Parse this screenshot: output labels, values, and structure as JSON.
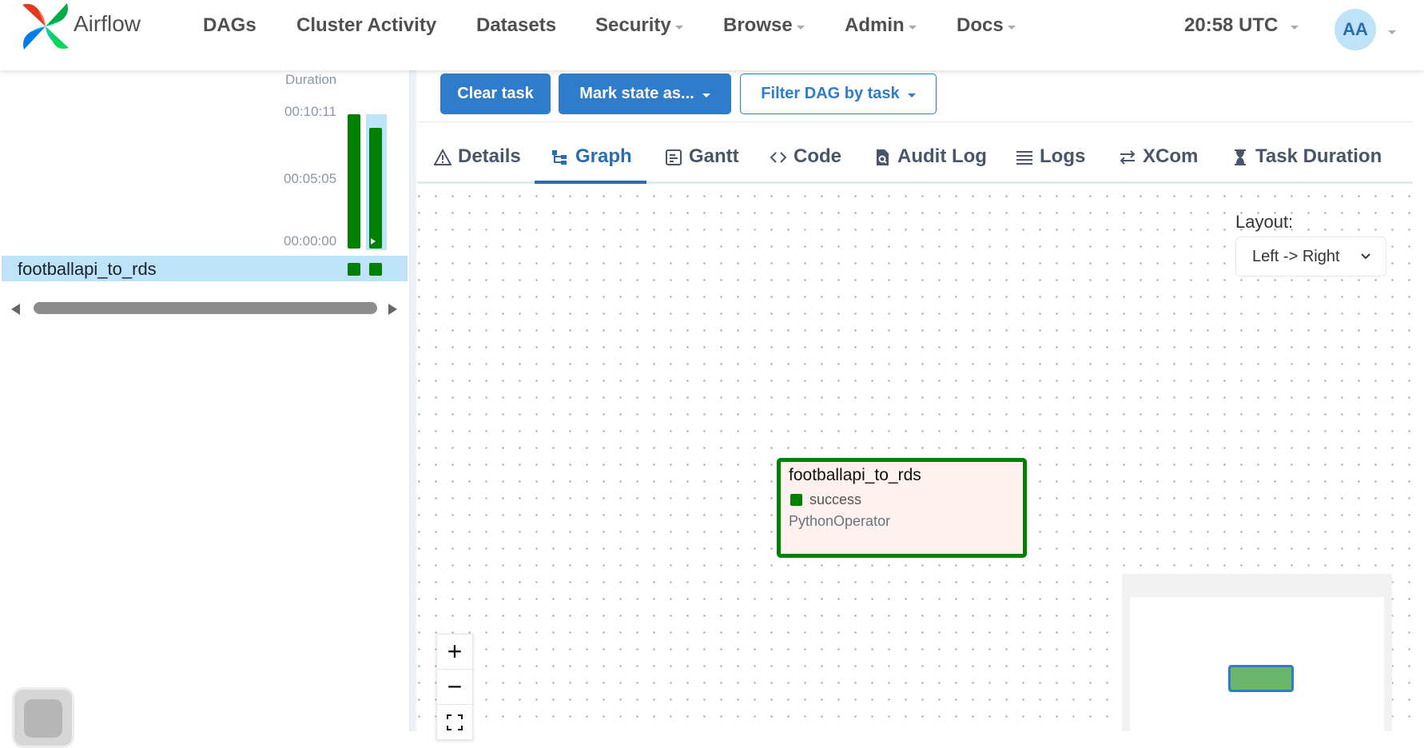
{
  "navbar": {
    "brand": "Airflow",
    "items": [
      {
        "label": "DAGs",
        "dropdown": false
      },
      {
        "label": "Cluster Activity",
        "dropdown": false
      },
      {
        "label": "Datasets",
        "dropdown": false
      },
      {
        "label": "Security",
        "dropdown": true
      },
      {
        "label": "Browse",
        "dropdown": true
      },
      {
        "label": "Admin",
        "dropdown": true
      },
      {
        "label": "Docs",
        "dropdown": true
      }
    ],
    "clock": "20:58 UTC",
    "avatar_initials": "AA"
  },
  "grid": {
    "duration_header": "Duration",
    "ticks": [
      "00:10:11",
      "00:05:05",
      "00:00:00"
    ],
    "runs": [
      {
        "duration_fraction": 1.0,
        "state": "success",
        "selected": false
      },
      {
        "duration_fraction": 0.9,
        "state": "success",
        "selected": true
      }
    ],
    "task_row": {
      "label": "footballapi_to_rds"
    }
  },
  "toolbar": {
    "clear_task": "Clear task",
    "mark_state": "Mark state as...",
    "filter_dag": "Filter DAG by task"
  },
  "tabs": [
    {
      "label": "Details",
      "icon": "warning-triangle-icon"
    },
    {
      "label": "Graph",
      "icon": "graph-icon",
      "active": true
    },
    {
      "label": "Gantt",
      "icon": "gantt-icon"
    },
    {
      "label": "Code",
      "icon": "code-icon"
    },
    {
      "label": "Audit Log",
      "icon": "audit-log-icon"
    },
    {
      "label": "Logs",
      "icon": "logs-icon"
    },
    {
      "label": "XCom",
      "icon": "xcom-icon"
    },
    {
      "label": "Task Duration",
      "icon": "hourglass-icon"
    }
  ],
  "graph": {
    "layout_label": "Layout:",
    "layout_value": "Left -> Right",
    "node": {
      "task_id": "footballapi_to_rds",
      "state": "success",
      "operator": "PythonOperator"
    },
    "zoom": {
      "in": "+",
      "out": "−"
    }
  },
  "colors": {
    "success": "#008000",
    "primary": "#2f7dca",
    "selected_row": "#bee3f8",
    "node_bg": "#fff1ed"
  }
}
